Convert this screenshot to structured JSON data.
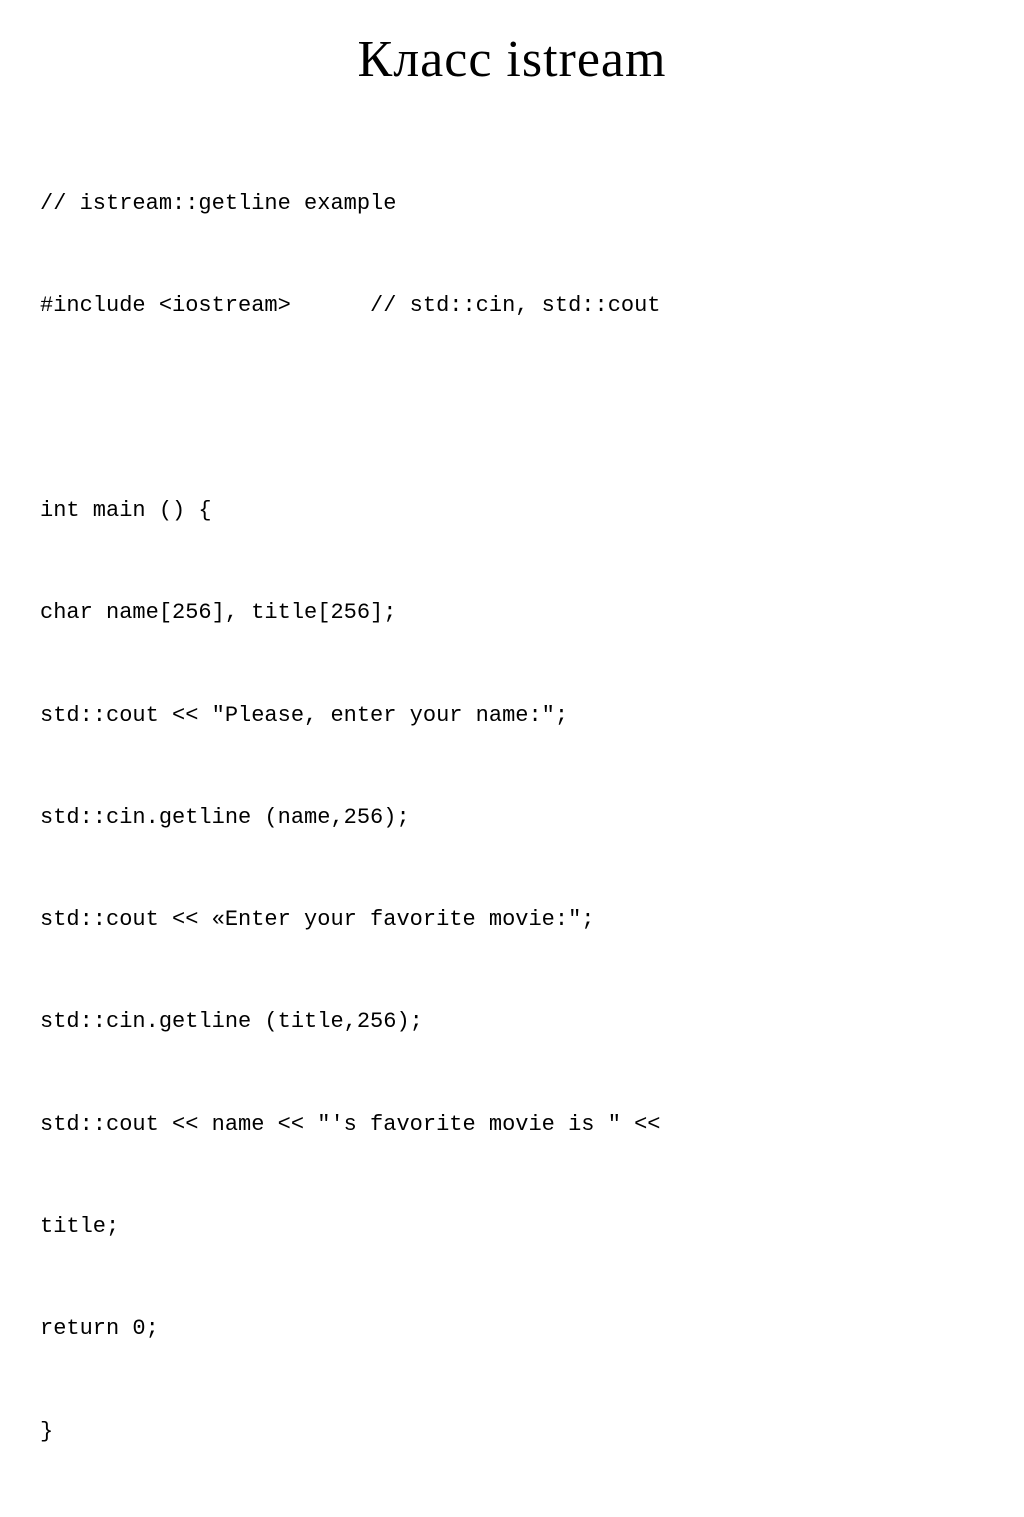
{
  "slide": {
    "title": "Класс istream",
    "code_lines": [
      "// istream::getline example",
      "#include <iostream>      // std::cin, std::cout",
      "",
      "int main () {",
      "char name[256], title[256];",
      "std::cout << \"Please, enter your name:\";",
      "std::cin.getline (name,256);",
      "std::cout << «Enter your favorite movie:\";",
      "std::cin.getline (title,256);",
      "std::cout << name << \"'s favorite movie is \" <<",
      "title;",
      "return 0;",
      "}"
    ]
  }
}
